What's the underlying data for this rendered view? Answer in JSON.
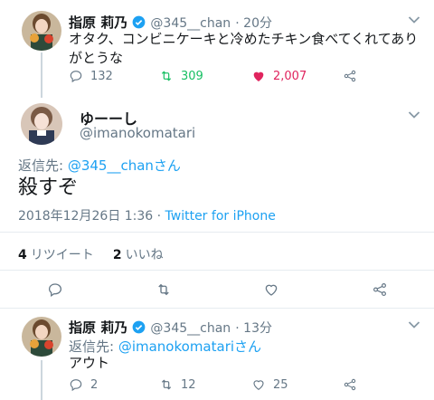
{
  "tweet1": {
    "author_name": "指原 莉乃",
    "handle": "@345__chan",
    "time": "20分",
    "text_line1": "オタク、コンビニケーキと冷めたチキン食べてくれてあり",
    "text_line2": "がとうな",
    "replies": "132",
    "retweets": "309",
    "likes": "2,007"
  },
  "focus_tweet": {
    "author_name": "ゆーーし",
    "handle": "@imanokomatari",
    "reply_prefix": "返信先: ",
    "reply_to": "@345__chanさん",
    "text": "殺すぞ",
    "date": "2018年12月26日 1:36",
    "via_sep": " · ",
    "client": "Twitter for iPhone",
    "retweet_count": "4",
    "retweet_label": "リツイート",
    "like_count": "2",
    "like_label": "いいね"
  },
  "tweet3": {
    "author_name": "指原 莉乃",
    "handle": "@345__chan",
    "time": "13分",
    "reply_prefix": "返信先: ",
    "reply_to": "@imanokomatariさん",
    "text": "アウト",
    "replies": "2",
    "retweets": "12",
    "likes": "25"
  },
  "colors": {
    "link": "#1da1f2",
    "like_active": "#e0245e",
    "retweet_active": "#17bf63",
    "muted": "#657786"
  }
}
